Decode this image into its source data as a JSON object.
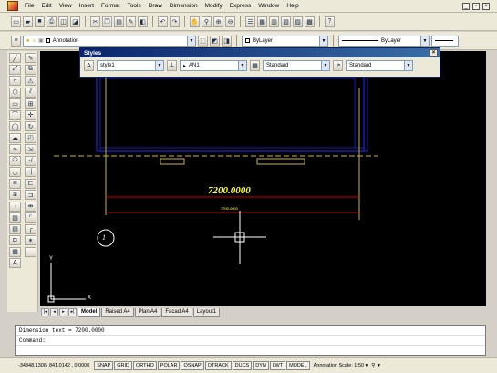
{
  "menu": {
    "items": [
      "File",
      "Edit",
      "View",
      "Insert",
      "Format",
      "Tools",
      "Draw",
      "Dimension",
      "Modify",
      "Express",
      "Window",
      "Help"
    ]
  },
  "layer_toolbar": {
    "layer_value": "Annotation",
    "color_value": "ByLayer",
    "linetype_value": "ByLayer"
  },
  "styles_panel": {
    "title": "Styles",
    "text_style": "style1",
    "dim_style": "AN1",
    "table_style": "Standard",
    "multileader_style": "Standard"
  },
  "drawing": {
    "dimension_text": "7200.0000",
    "dimension_text_small": "7200.0000",
    "grid_bubble": "1",
    "ucs_x": "X",
    "ucs_y": "Y"
  },
  "tabs": [
    "Model",
    "Raised A4",
    "Plan A4",
    "Facad A4",
    "Layout1"
  ],
  "command_line": {
    "history": "Dimension text = 7200.0000",
    "prompt": "Command:"
  },
  "status": {
    "coords": "-34348.1306, 841.0142 , 0.0000",
    "toggles": [
      "SNAP",
      "GRID",
      "ORTHO",
      "POLAR",
      "OSNAP",
      "OTRACK",
      "DUCS",
      "DYN",
      "LWT",
      "MODEL"
    ],
    "annotation_scale": "Annotation Scale: 1:50 ▾"
  },
  "colors": {
    "background": "#000000",
    "dimension": "#ffff33",
    "wall": "#0000aa",
    "dim_line": "#cc0000"
  }
}
